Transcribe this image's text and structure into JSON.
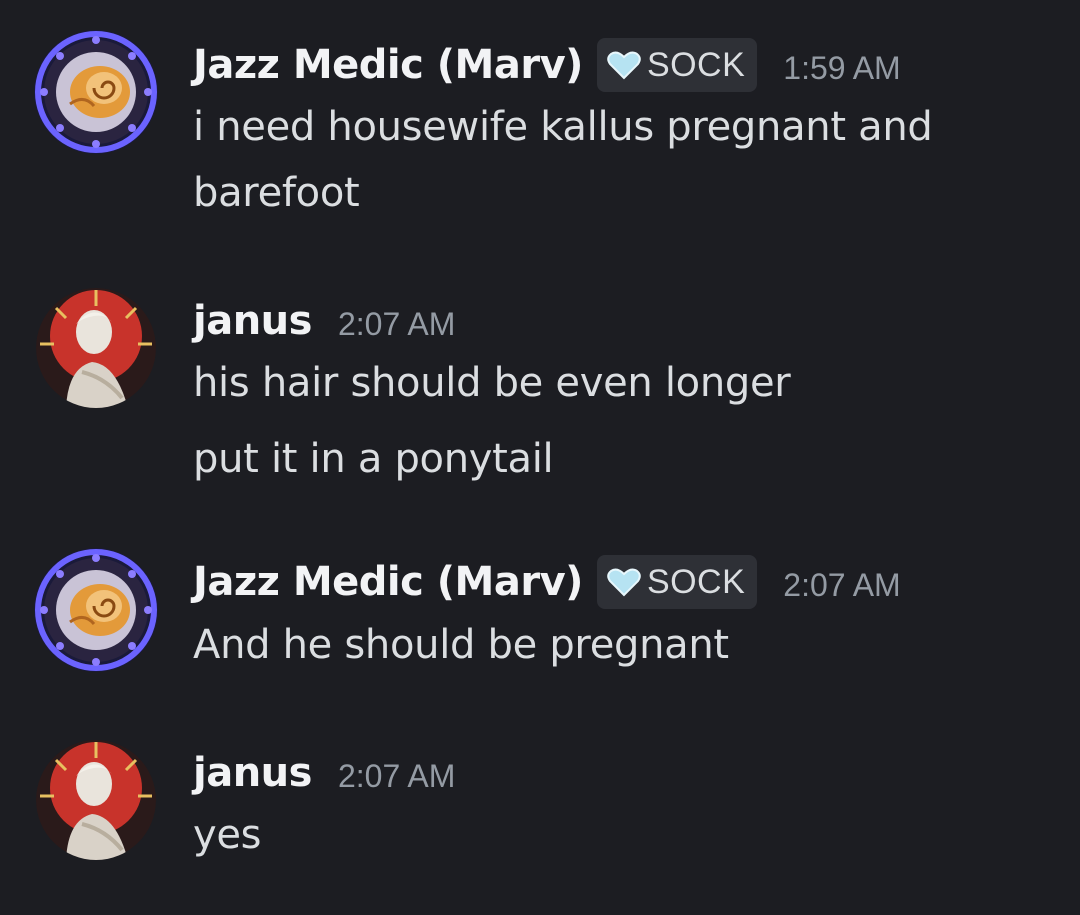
{
  "messages": [
    {
      "author": "Jazz Medic (Marv)",
      "tag": "SOCK",
      "timestamp": "1:59 AM",
      "lines": [
        "i need housewife kallus pregnant and",
        "barefoot"
      ]
    },
    {
      "author": "janus",
      "timestamp": "2:07 AM",
      "lines": [
        "his hair should be even longer",
        "put it in a ponytail"
      ]
    },
    {
      "author": "Jazz Medic (Marv)",
      "tag": "SOCK",
      "timestamp": "2:07 AM",
      "lines": [
        "And he should be pregnant"
      ]
    },
    {
      "author": "janus",
      "timestamp": "2:07 AM",
      "lines": [
        "yes"
      ]
    }
  ],
  "colors": {
    "background": "#1c1d22",
    "username": "#f2f3f5",
    "message_text": "#dbdee1",
    "timestamp": "#949ba4",
    "tag_background": "#2e3036",
    "tag_heart": "#b6e3f2"
  },
  "icons": {
    "tag": "heart-icon",
    "avatar_marv": "nautilus-shell-avatar",
    "avatar_janus": "statue-avatar"
  }
}
